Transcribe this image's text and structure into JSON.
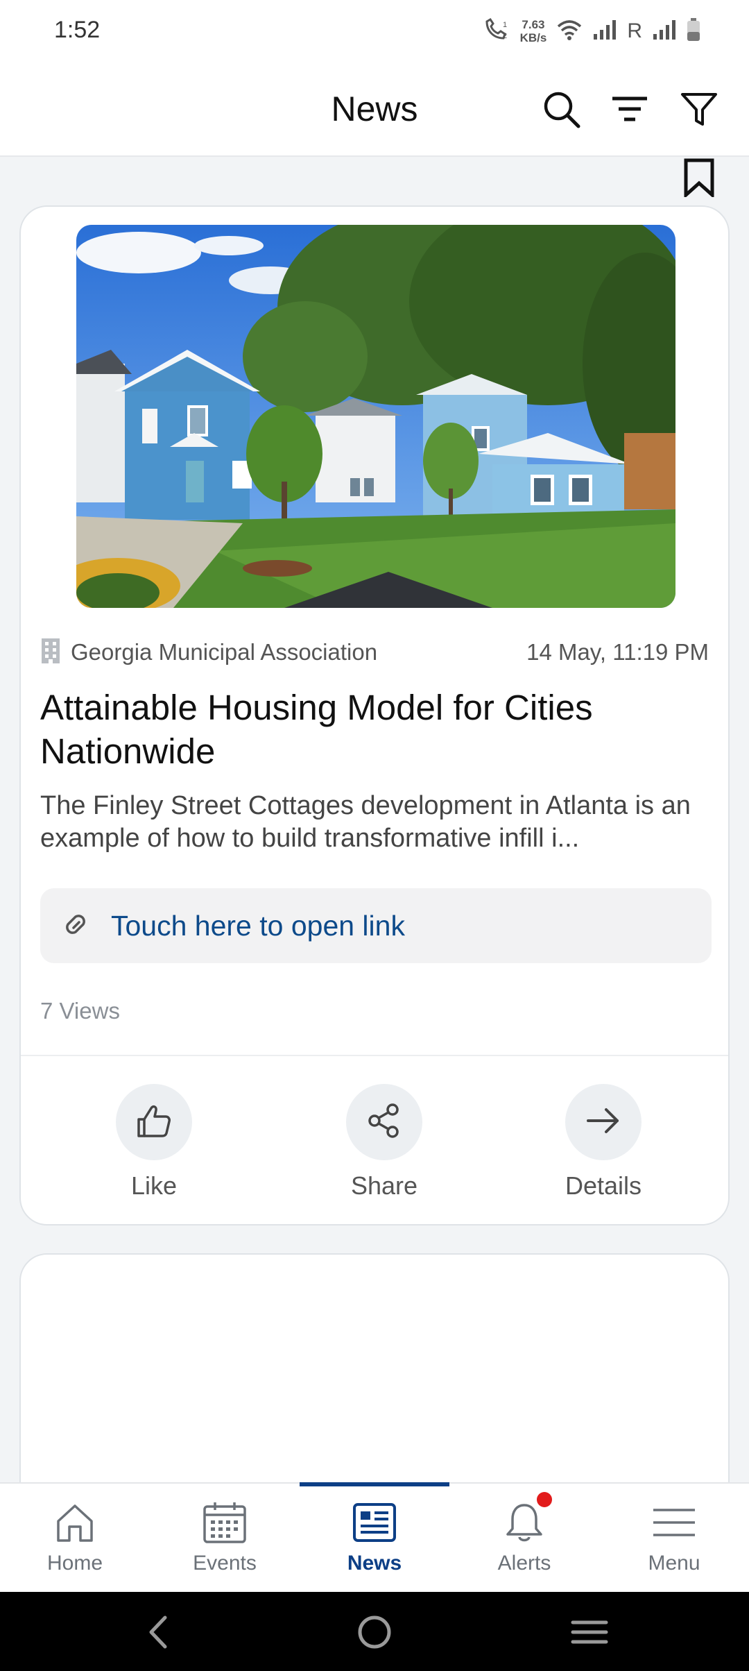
{
  "status_bar": {
    "time": "1:52",
    "net_speed_value": "7.63",
    "net_speed_unit": "KB/s",
    "roaming_indicator": "R"
  },
  "header": {
    "title": "News",
    "icons": [
      "search-icon",
      "sort-icon",
      "filter-icon"
    ]
  },
  "article": {
    "source": "Georgia Municipal Association",
    "date": "14 May, 11:19 PM",
    "title": "Attainable Housing Model for Cities Nationwide",
    "description": "The Finley Street Cottages development in Atlanta is an example of how to build transformative infill i...",
    "link_label": "Touch here to open link",
    "views": "7 Views",
    "actions": {
      "like": "Like",
      "share": "Share",
      "details": "Details"
    }
  },
  "bottom_nav": {
    "items": [
      {
        "label": "Home",
        "icon": "home-icon"
      },
      {
        "label": "Events",
        "icon": "calendar-icon"
      },
      {
        "label": "News",
        "icon": "news-icon"
      },
      {
        "label": "Alerts",
        "icon": "bell-icon"
      },
      {
        "label": "Menu",
        "icon": "hamburger-icon"
      }
    ],
    "active": "News"
  },
  "colors": {
    "accent": "#0d3f86",
    "link": "#0d4a8a",
    "alert_dot": "#e21b1b"
  }
}
